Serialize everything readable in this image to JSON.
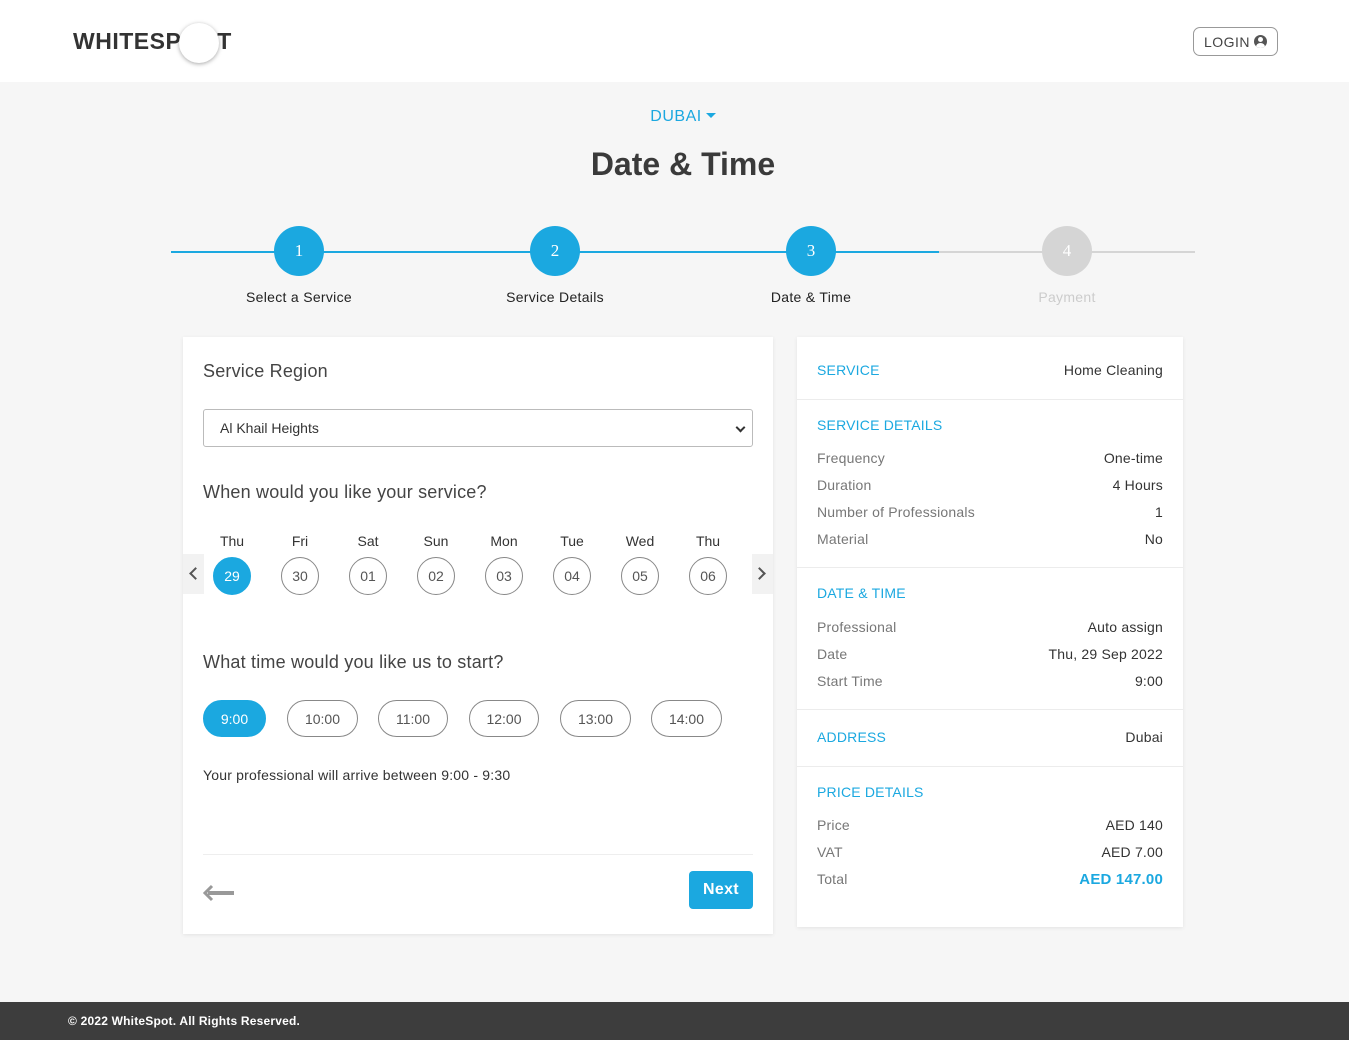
{
  "header": {
    "logo_left": "WHITESP",
    "logo_right": "T",
    "login_label": "LOGIN"
  },
  "city": "DUBAI",
  "title": "Date & Time",
  "steps": [
    {
      "num": "1",
      "label": "Select a Service",
      "active": true
    },
    {
      "num": "2",
      "label": "Service Details",
      "active": true
    },
    {
      "num": "3",
      "label": "Date & Time",
      "active": true
    },
    {
      "num": "4",
      "label": "Payment",
      "active": false
    }
  ],
  "form": {
    "region_heading": "Service Region",
    "region_value": "Al Khail Heights",
    "date_heading": "When would you like your service?",
    "days": [
      {
        "name": "Thu",
        "num": "29",
        "selected": true
      },
      {
        "name": "Fri",
        "num": "30",
        "selected": false
      },
      {
        "name": "Sat",
        "num": "01",
        "selected": false
      },
      {
        "name": "Sun",
        "num": "02",
        "selected": false
      },
      {
        "name": "Mon",
        "num": "03",
        "selected": false
      },
      {
        "name": "Tue",
        "num": "04",
        "selected": false
      },
      {
        "name": "Wed",
        "num": "05",
        "selected": false
      },
      {
        "name": "Thu",
        "num": "06",
        "selected": false
      }
    ],
    "time_heading": "What time would you like us to start?",
    "times": [
      {
        "label": "9:00",
        "selected": true
      },
      {
        "label": "10:00",
        "selected": false
      },
      {
        "label": "11:00",
        "selected": false
      },
      {
        "label": "12:00",
        "selected": false
      },
      {
        "label": "13:00",
        "selected": false
      },
      {
        "label": "14:00",
        "selected": false
      }
    ],
    "arrive_note": "Your professional will arrive between 9:00 - 9:30",
    "next_label": "Next"
  },
  "summary": {
    "service": {
      "label": "SERVICE",
      "value": "Home Cleaning"
    },
    "details": {
      "label": "SERVICE DETAILS",
      "frequency_k": "Frequency",
      "frequency_v": "One-time",
      "duration_k": "Duration",
      "duration_v": "4 Hours",
      "pros_k": "Number of Professionals",
      "pros_v": "1",
      "material_k": "Material",
      "material_v": "No"
    },
    "datetime": {
      "label": "DATE & TIME",
      "professional_k": "Professional",
      "professional_v": "Auto assign",
      "date_k": "Date",
      "date_v": "Thu, 29 Sep 2022",
      "start_k": "Start Time",
      "start_v": "9:00"
    },
    "address": {
      "label": "ADDRESS",
      "value": "Dubai"
    },
    "price": {
      "label": "PRICE DETAILS",
      "price_k": "Price",
      "price_v": "AED 140",
      "vat_k": "VAT",
      "vat_v": "AED 7.00",
      "total_k": "Total",
      "total_v": "AED 147.00"
    }
  },
  "footer": "© 2022 WhiteSpot. All Rights Reserved.",
  "colors": {
    "accent": "#1ba8e0",
    "inactive": "#d5d5d5",
    "footer_bg": "#3d3d3d"
  }
}
